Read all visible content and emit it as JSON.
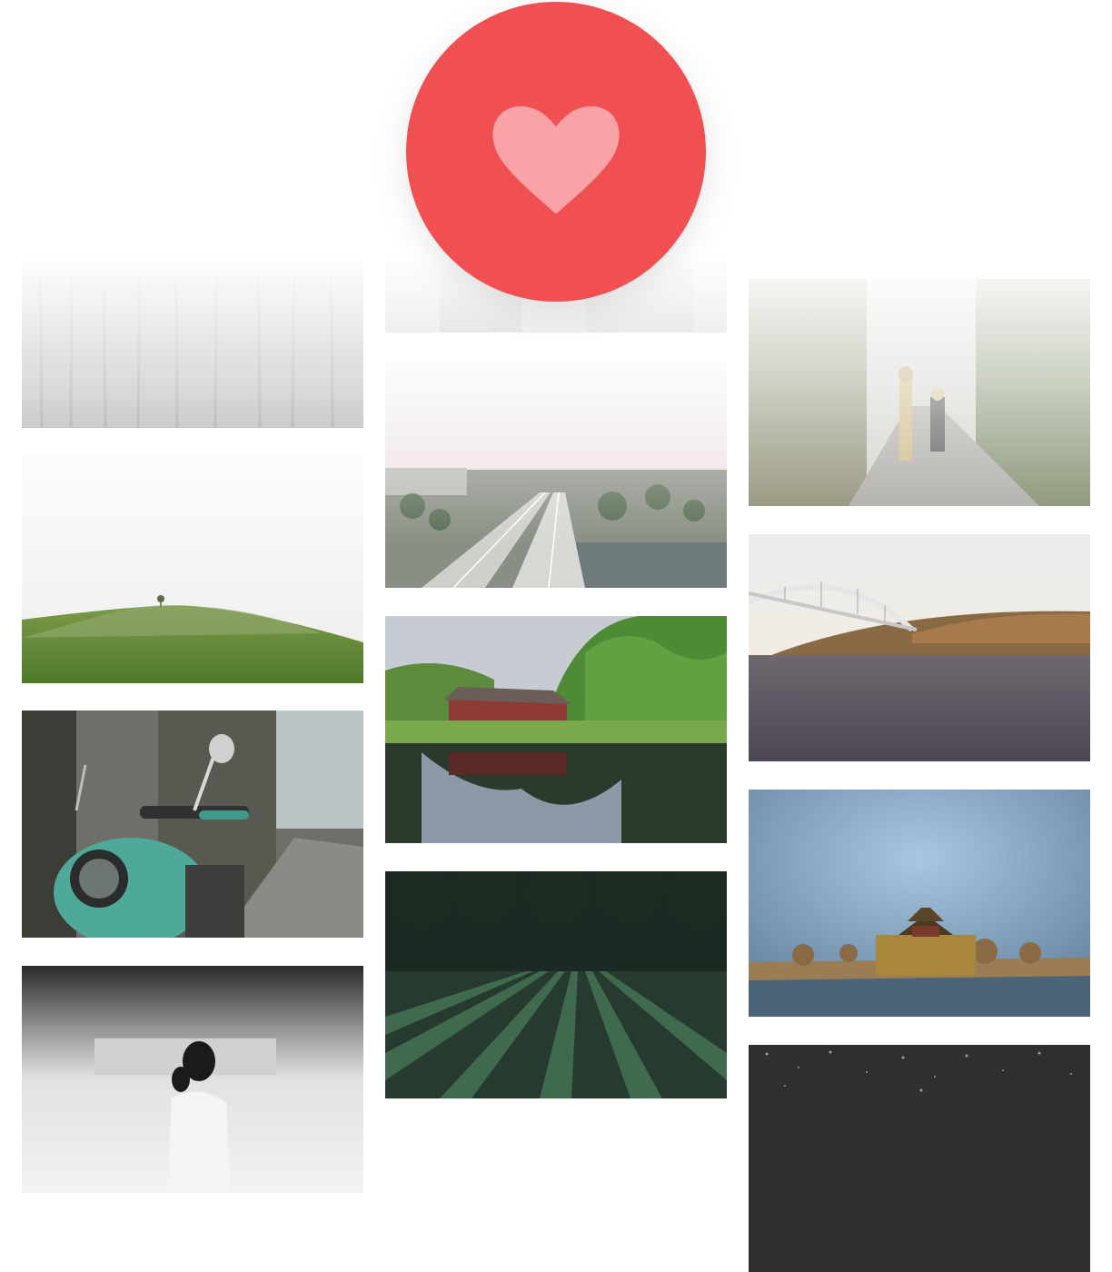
{
  "like_button": {
    "icon": "heart-icon",
    "circle_color": "#f05052",
    "heart_color": "#f9a3a6"
  },
  "gallery": {
    "photos": [
      {
        "subject": "misty-forest",
        "column": 1,
        "row": 1
      },
      {
        "subject": "green-hill-with-lone-tree",
        "column": 1,
        "row": 2
      },
      {
        "subject": "teal-scooter-in-alley",
        "column": 1,
        "row": 3
      },
      {
        "subject": "woman-in-motion-bw",
        "column": 1,
        "row": 4
      },
      {
        "subject": "faded-top-image",
        "column": 2,
        "row": 1
      },
      {
        "subject": "city-highway-aerial",
        "column": 2,
        "row": 2
      },
      {
        "subject": "red-cabin-lake-reflection",
        "column": 2,
        "row": 3
      },
      {
        "subject": "tea-field-rows",
        "column": 2,
        "row": 4
      },
      {
        "subject": "children-on-garden-path",
        "column": 3,
        "row": 1
      },
      {
        "subject": "arch-bridge-over-water",
        "column": 3,
        "row": 2
      },
      {
        "subject": "palace-tower-by-moat",
        "column": 3,
        "row": 3
      },
      {
        "subject": "dark-starry-texture",
        "column": 3,
        "row": 4
      }
    ]
  }
}
